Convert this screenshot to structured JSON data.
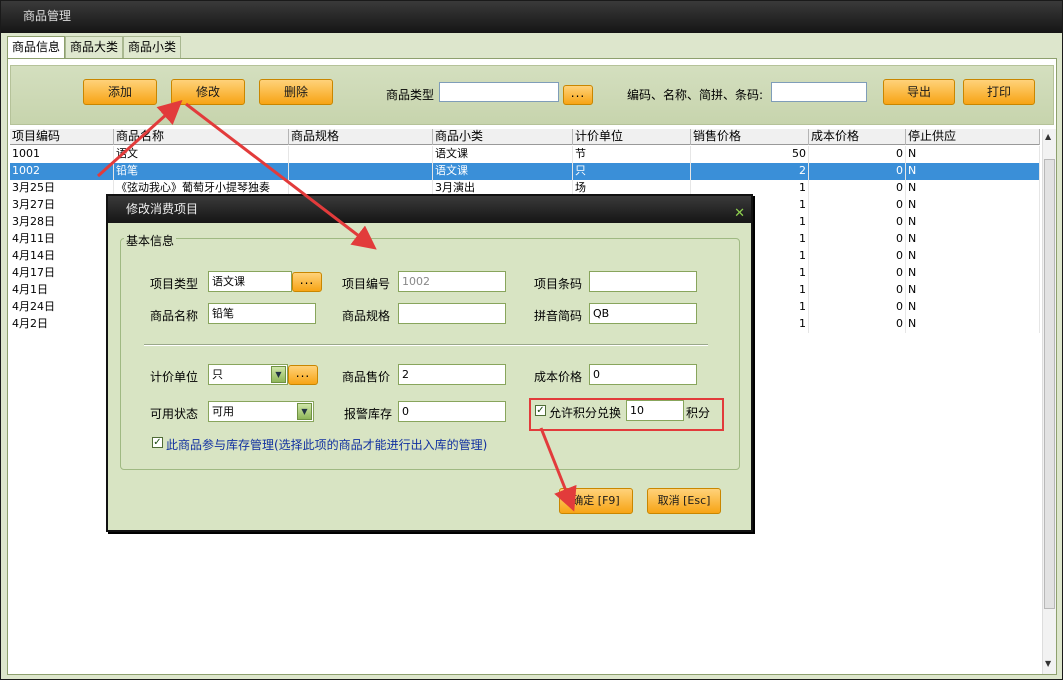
{
  "window": {
    "title": "商品管理"
  },
  "tabs": [
    "商品信息",
    "商品大类",
    "商品小类"
  ],
  "toolbar": {
    "add_label": "添加",
    "edit_label": "修改",
    "delete_label": "删除",
    "category_label": "商品类型",
    "category_value": "",
    "browse_label": "...",
    "search_label": "编码、名称、简拼、条码:",
    "search_value": "",
    "export_label": "导出",
    "print_label": "打印"
  },
  "table": {
    "columns": [
      "项目编码",
      "商品名称",
      "商品规格",
      "商品小类",
      "计价单位",
      "销售价格",
      "成本价格",
      "停止供应"
    ],
    "rows": [
      [
        "1001",
        "语文",
        "",
        "语文课",
        "节",
        "50",
        "0",
        "N"
      ],
      [
        "1002",
        "铅笔",
        "",
        "语文课",
        "只",
        "2",
        "0",
        "N"
      ],
      [
        "3月25日",
        "《弦动我心》葡萄牙小提琴独奏",
        "",
        "3月演出",
        "场",
        "1",
        "0",
        "N"
      ],
      [
        "3月27日",
        "",
        "",
        "",
        "",
        "1",
        "0",
        "N"
      ],
      [
        "3月28日",
        "",
        "",
        "",
        "",
        "1",
        "0",
        "N"
      ],
      [
        "4月11日",
        "",
        "",
        "",
        "",
        "1",
        "0",
        "N"
      ],
      [
        "4月14日",
        "",
        "",
        "",
        "",
        "1",
        "0",
        "N"
      ],
      [
        "4月17日",
        "",
        "",
        "",
        "",
        "1",
        "0",
        "N"
      ],
      [
        "4月1日",
        "",
        "",
        "",
        "",
        "1",
        "0",
        "N"
      ],
      [
        "4月24日",
        "",
        "",
        "",
        "",
        "1",
        "0",
        "N"
      ],
      [
        "4月2日",
        "",
        "",
        "",
        "",
        "1",
        "0",
        "N"
      ]
    ],
    "selected_row_index": 1
  },
  "dialog": {
    "title": "修改消费项目",
    "close_label": "✕",
    "group_label": "基本信息",
    "fields": {
      "item_type_label": "项目类型",
      "item_type_value": "语文课",
      "item_code_label": "项目编号",
      "item_code_value": "1002",
      "barcode_label": "项目条码",
      "barcode_value": "",
      "name_label": "商品名称",
      "name_value": "铅笔",
      "spec_label": "商品规格",
      "spec_value": "",
      "pinyin_label": "拼音简码",
      "pinyin_value": "QB",
      "unit_label": "计价单位",
      "unit_value": "只",
      "price_label": "商品售价",
      "price_value": "2",
      "cost_label": "成本价格",
      "cost_value": "0",
      "status_label": "可用状态",
      "status_value": "可用",
      "stock_alarm_label": "报警库存",
      "stock_alarm_value": "0",
      "allow_points_label": "允许积分兑换",
      "allow_points_checked": true,
      "points_value": "10",
      "points_unit": "积分",
      "inventory_label": "此商品参与库存管理(选择此项的商品才能进行出入库的管理)",
      "inventory_checked": true
    },
    "ok_label": "确定 [F9]",
    "cancel_label": "取消 [Esc]"
  },
  "colors": {
    "accent_orange": "#f7a415",
    "selection_blue": "#3a8fd8",
    "panel_green": "#d8e4c3",
    "annotation_red": "#e23b3b"
  }
}
